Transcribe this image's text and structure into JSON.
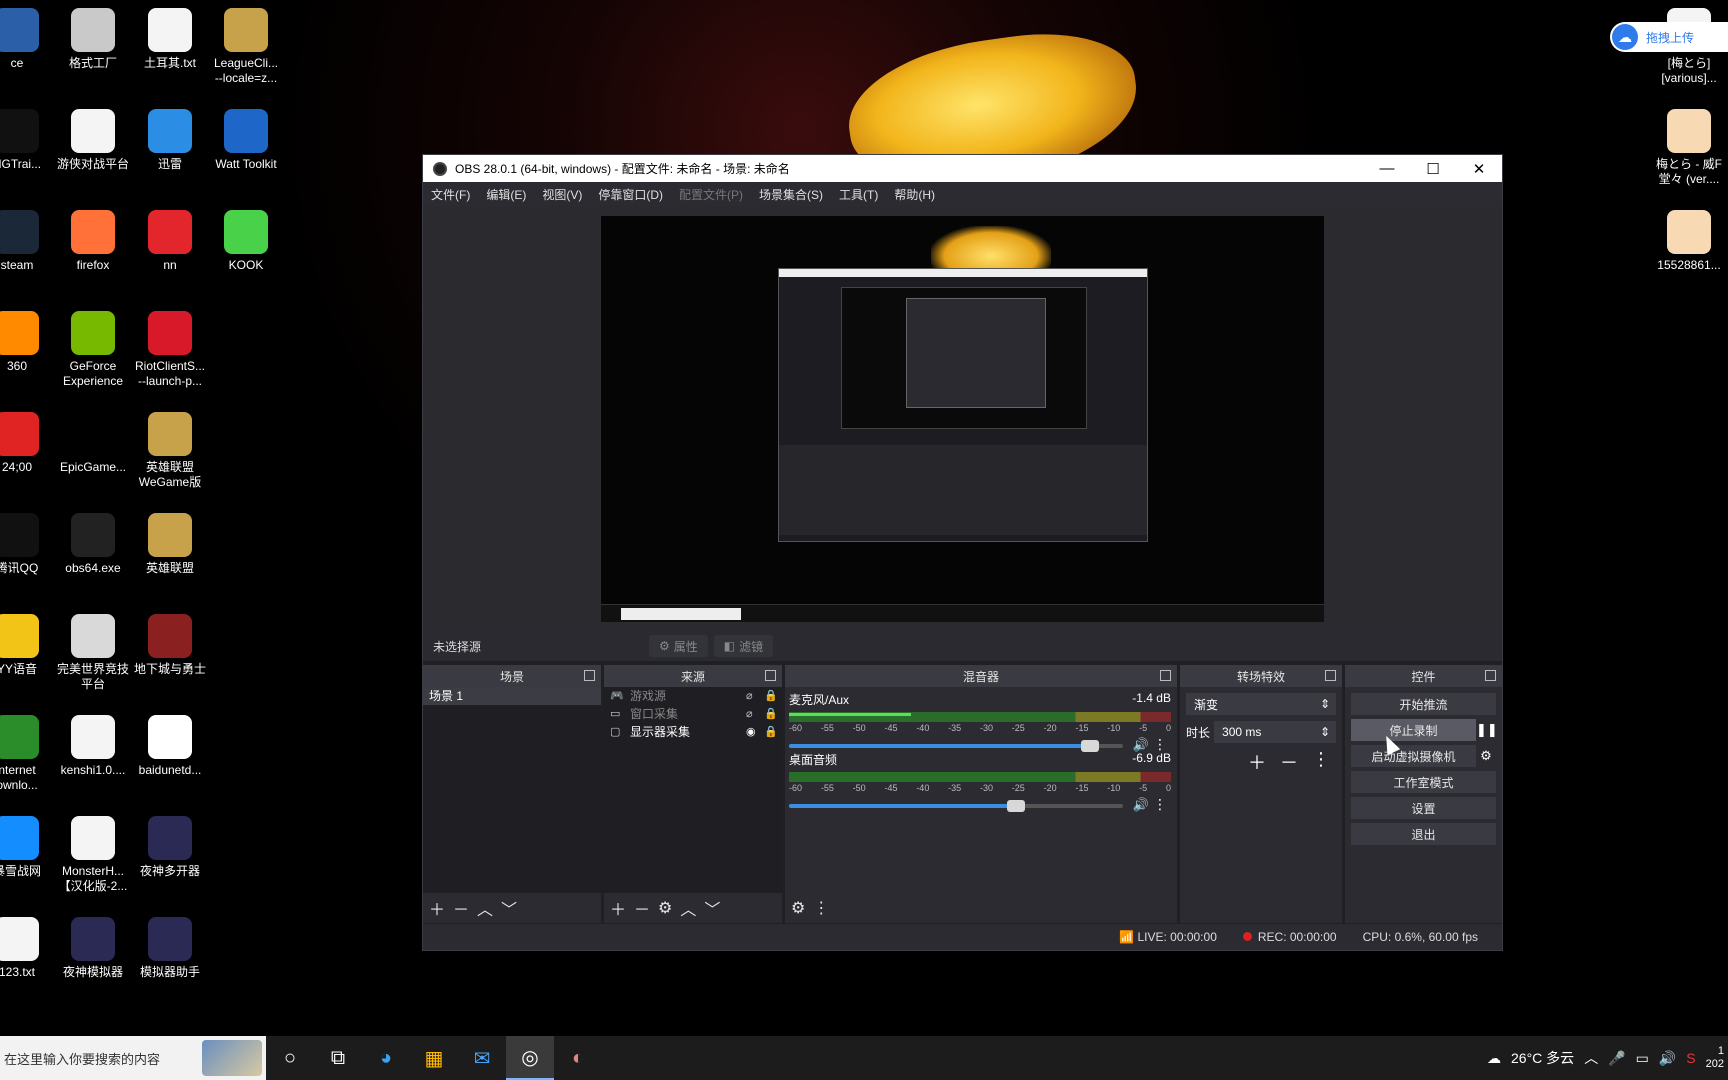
{
  "desktop": {
    "icons_col0": [
      {
        "label": "ce",
        "color": "#2b5fa8"
      },
      {
        "label": "NGTrai...",
        "color": "#111"
      },
      {
        "label": "steam",
        "color": "#1b2838"
      },
      {
        "label": "360",
        "color": "#ff8a00"
      },
      {
        "label": "24;00",
        "color": "#e02424"
      },
      {
        "label": "腾讯QQ",
        "color": "#111"
      },
      {
        "label": "YY语音",
        "color": "#f2c418"
      },
      {
        "label": "nternet\nownlo...",
        "color": "#2a8d2a"
      },
      {
        "label": "暴雪战网",
        "color": "#148eff"
      },
      {
        "label": "123.txt",
        "color": "#f4f4f4"
      }
    ],
    "icons_col1": [
      {
        "label": "格式工厂",
        "color": "#c9c9c9"
      },
      {
        "label": "游侠对战平台",
        "color": "#f4f4f4"
      },
      {
        "label": "firefox",
        "color": "#ff7139"
      },
      {
        "label": "GeForce\nExperience",
        "color": "#76b900"
      },
      {
        "label": "EpicGame...",
        "color": "#000"
      },
      {
        "label": "obs64.exe",
        "color": "#222"
      },
      {
        "label": "完美世界竞技\n平台",
        "color": "#d9d9d9"
      },
      {
        "label": "kenshi1.0....",
        "color": "#f4f4f4"
      },
      {
        "label": "MonsterH...\n【汉化版-2...",
        "color": "#f4f4f4"
      },
      {
        "label": "夜神模拟器",
        "color": "#2a2a55"
      }
    ],
    "icons_col2": [
      {
        "label": "土耳其.txt",
        "color": "#f4f4f4"
      },
      {
        "label": "迅雷",
        "color": "#2b8de3"
      },
      {
        "label": "nn",
        "color": "#e3262b"
      },
      {
        "label": "RiotClientS...\n--launch-p...",
        "color": "#d8192a"
      },
      {
        "label": "英雄联盟\nWeGame版",
        "color": "#c7a24b"
      },
      {
        "label": "英雄联盟",
        "color": "#c7a24b"
      },
      {
        "label": "地下城与勇士",
        "color": "#8a2020"
      },
      {
        "label": "baidunetd...",
        "color": "#ffffff"
      },
      {
        "label": "夜神多开器",
        "color": "#2a2a55"
      },
      {
        "label": "模拟器助手",
        "color": "#2a2a55"
      }
    ],
    "icons_col3": [
      {
        "label": "LeagueCli...\n--locale=z...",
        "color": "#c7a24b"
      },
      {
        "label": "Watt Toolkit",
        "color": "#1e66c8"
      },
      {
        "label": "KOOK",
        "color": "#49d14a"
      }
    ],
    "icons_right": [
      {
        "label": "[梅とら]\n[various]...",
        "color": "#f4f4f4"
      },
      {
        "label": "梅とら - 威F\n堂々 (ver....",
        "color": "#f7d9b4"
      },
      {
        "label": "15528861...",
        "color": "#f7d9b4"
      }
    ],
    "upload_widget": "拖拽上传"
  },
  "obs": {
    "title": "OBS 28.0.1 (64-bit, windows) - 配置文件: 未命名 - 场景: 未命名",
    "window_buttons": {
      "minimize": "—",
      "maximize": "☐",
      "close": "✕"
    },
    "menu": [
      {
        "label": "文件(F)",
        "disabled": false
      },
      {
        "label": "编辑(E)",
        "disabled": false
      },
      {
        "label": "视图(V)",
        "disabled": false
      },
      {
        "label": "停靠窗口(D)",
        "disabled": false
      },
      {
        "label": "配置文件(P)",
        "disabled": true
      },
      {
        "label": "场景集合(S)",
        "disabled": false
      },
      {
        "label": "工具(T)",
        "disabled": false
      },
      {
        "label": "帮助(H)",
        "disabled": false
      }
    ],
    "context_bar": {
      "no_source": "未选择源",
      "properties": "属性",
      "filters": "滤镜"
    },
    "docks": {
      "scenes": {
        "title": "场景",
        "items": [
          "场景 1"
        ]
      },
      "sources": {
        "title": "来源",
        "items": [
          {
            "name": "游戏源",
            "icon": "gamepad-icon",
            "visible": false
          },
          {
            "name": "窗口采集",
            "icon": "window-icon",
            "visible": false
          },
          {
            "name": "显示器采集",
            "icon": "monitor-icon",
            "visible": true
          }
        ]
      },
      "mixer": {
        "title": "混音器",
        "channels": [
          {
            "name": "麦克风/Aux",
            "db": "-1.4 dB",
            "level": 0.32,
            "volume": 0.9
          },
          {
            "name": "桌面音频",
            "db": "-6.9 dB",
            "level": 0.0,
            "volume": 0.68
          }
        ],
        "scale": [
          "-60",
          "-55",
          "-50",
          "-45",
          "-40",
          "-35",
          "-30",
          "-25",
          "-20",
          "-15",
          "-10",
          "-5",
          "0"
        ]
      },
      "transitions": {
        "title": "转场特效",
        "type": "渐变",
        "duration_label": "时长",
        "duration": "300 ms"
      },
      "controls": {
        "title": "控件",
        "buttons": [
          "开始推流",
          "停止录制",
          "启动虚拟摄像机",
          "工作室模式",
          "设置",
          "退出"
        ]
      }
    },
    "status": {
      "live": "LIVE: 00:00:00",
      "rec": "REC: 00:00:00",
      "cpu": "CPU: 0.6%, 60.00 fps"
    }
  },
  "taskbar": {
    "search_placeholder": "在这里输入你要搜索的内容",
    "weather": "26°C 多云",
    "clock_partial": "1",
    "date_partial": "202"
  }
}
